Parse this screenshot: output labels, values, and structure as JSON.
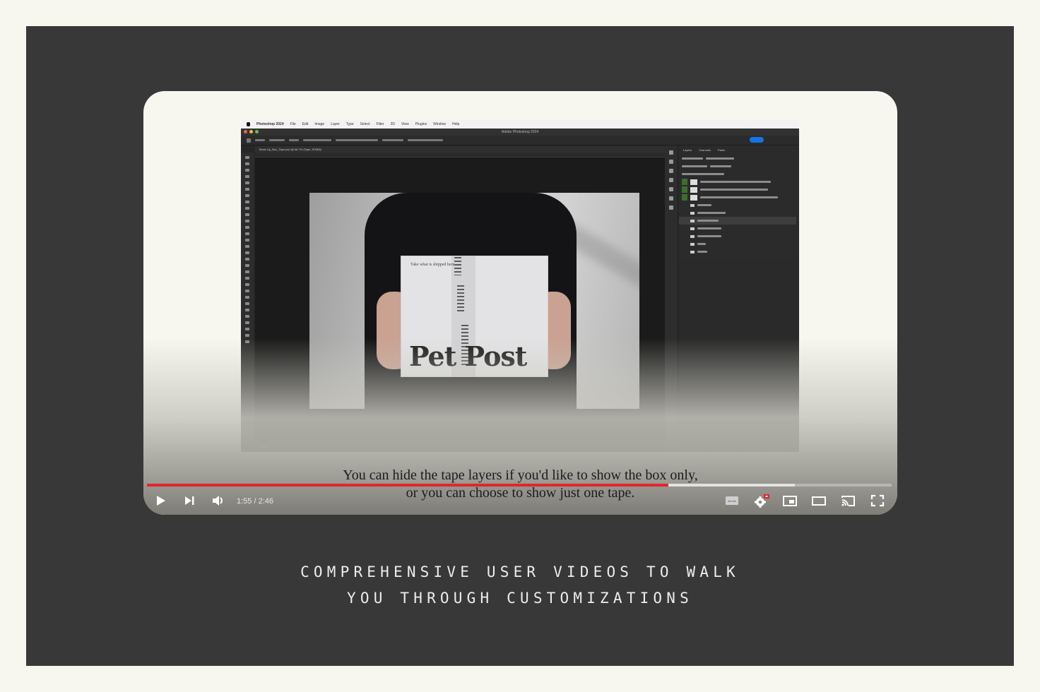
{
  "video": {
    "screen": {
      "menubar": {
        "items": [
          "Photoshop 2024",
          "File",
          "Edit",
          "Image",
          "Layer",
          "Type",
          "Select",
          "Filter",
          "3D",
          "View",
          "Plugins",
          "Window",
          "Help"
        ]
      },
      "window_title": "Adobe Photoshop 2024",
      "document_tab": "Mock-Up_Box_Tape.psd @ 66.7% (Tape, RGB/8)",
      "layers_panel": {
        "tabs": [
          "Layers",
          "Channels",
          "Paths"
        ]
      },
      "mockup": {
        "box_logo": "Pet Post",
        "box_small_text": "Take what is shipped here."
      }
    },
    "captions": {
      "line1": "You can hide the tape layers if you'd like to show the box only,",
      "line2": "or you can choose to show just one tape."
    },
    "player": {
      "current_time": "1:55",
      "duration": "2:46",
      "time_display": "1:55 / 2:46",
      "played_fraction": 0.7,
      "buffered_fraction": 0.87,
      "progress_color": "#e4252d",
      "buttons": {
        "play": "play-icon",
        "next": "next-icon",
        "volume": "volume-icon",
        "subtitles": "subtitles-icon",
        "settings": "settings-icon",
        "miniplayer": "miniplayer-icon",
        "theater": "theater-mode-icon",
        "cast": "cast-icon",
        "fullscreen": "fullscreen-icon"
      }
    }
  },
  "headline": {
    "line1": "COMPREHENSIVE USER VIDEOS TO WALK",
    "line2": "YOU THROUGH CUSTOMIZATIONS"
  }
}
